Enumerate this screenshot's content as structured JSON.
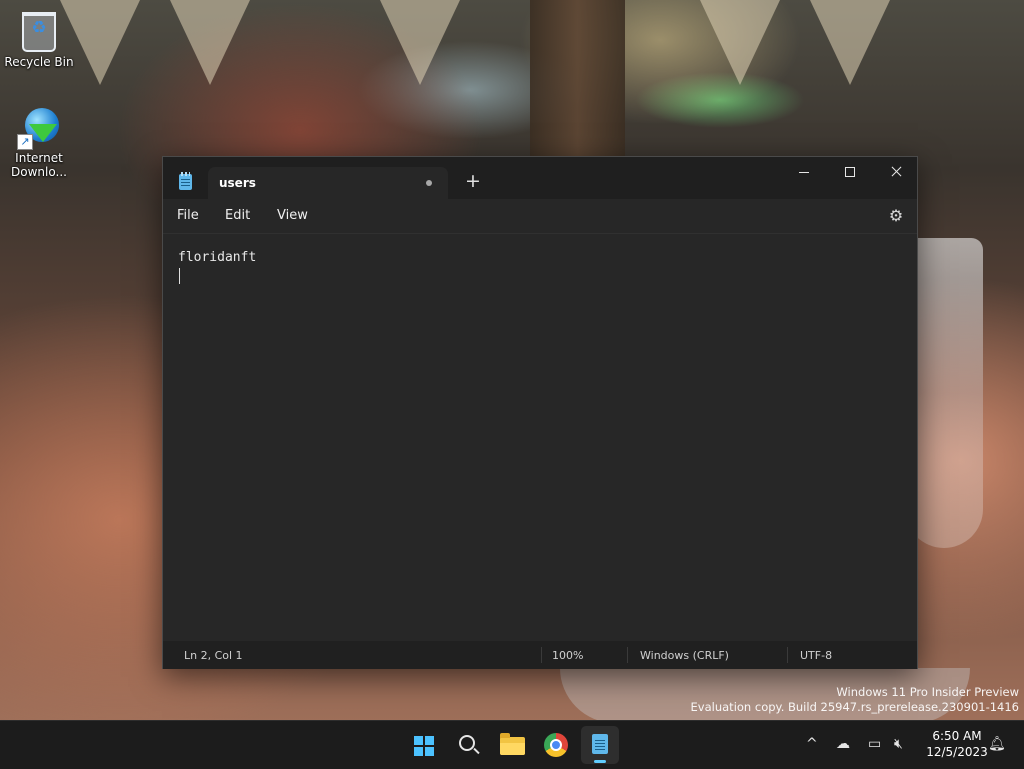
{
  "desktop": {
    "icons": [
      {
        "label": "Recycle Bin",
        "icon": "recycle-bin-icon"
      },
      {
        "label": "Internet Downlo...",
        "icon": "idm-icon"
      }
    ]
  },
  "notepad": {
    "tab_title": "users",
    "tab_modified": true,
    "new_tab_symbol": "+",
    "menu": {
      "file": "File",
      "edit": "Edit",
      "view": "View"
    },
    "content_lines": [
      "floridanft",
      ""
    ],
    "status": {
      "position": "Ln 2, Col 1",
      "zoom": "100%",
      "line_ending": "Windows (CRLF)",
      "encoding": "UTF-8"
    },
    "colors": {
      "accent": "#60cdff",
      "background": "#272727",
      "titlebar": "#1f1f1f"
    }
  },
  "watermark": {
    "line1": "Windows 11 Pro Insider Preview",
    "line2": "Evaluation copy. Build 25947.rs_prerelease.230901-1416"
  },
  "taskbar": {
    "apps": [
      "start-icon",
      "search-icon",
      "file-explorer-icon",
      "chrome-icon",
      "notepad-icon"
    ],
    "active_app": "notepad",
    "clock": {
      "time": "6:50 AM",
      "date": "12/5/2023"
    }
  }
}
